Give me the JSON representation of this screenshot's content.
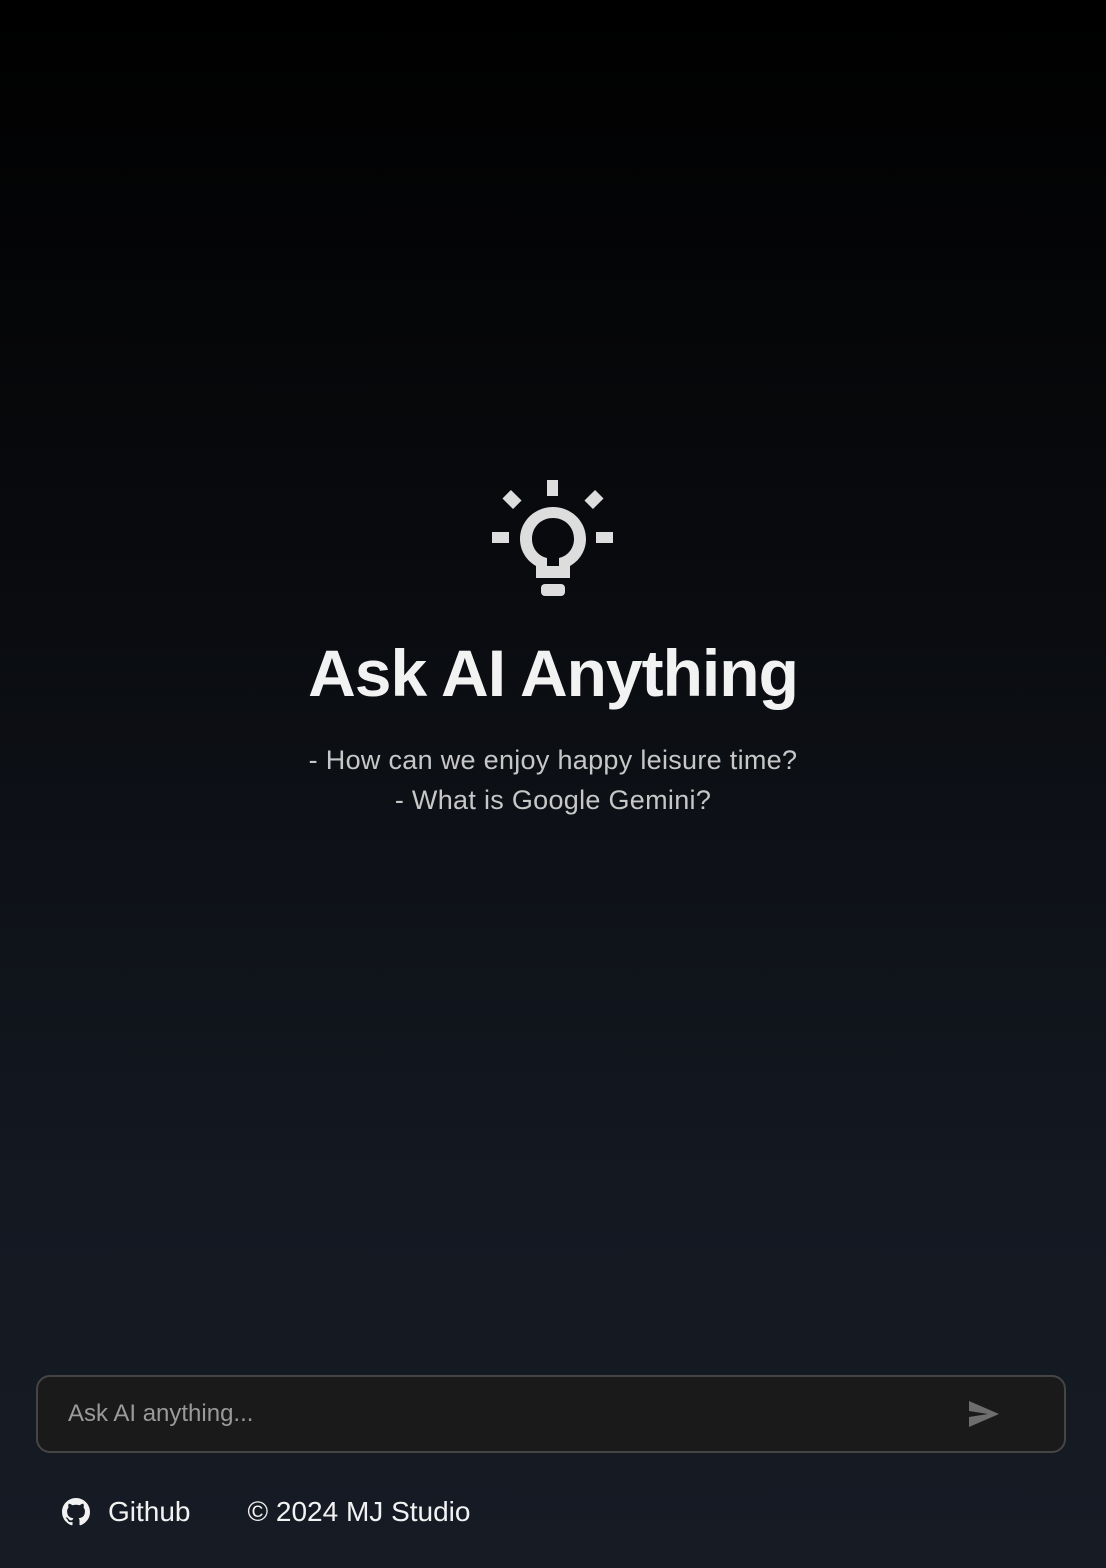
{
  "hero": {
    "icon": "lightbulb-icon",
    "title": "Ask AI Anything",
    "examples": [
      "- How can we enjoy happy leisure time?",
      "- What is Google Gemini?"
    ]
  },
  "chat_input": {
    "placeholder": "Ask AI anything...",
    "value": "",
    "send_icon": "send-icon"
  },
  "footer": {
    "github_icon": "github-icon",
    "github_label": "Github",
    "copyright": "© 2024 MJ Studio"
  },
  "colors": {
    "background_top": "#000000",
    "background_bottom": "#161b24",
    "icon": "#dddddd",
    "input_border": "#454545",
    "input_background": "#1a1a1a"
  }
}
